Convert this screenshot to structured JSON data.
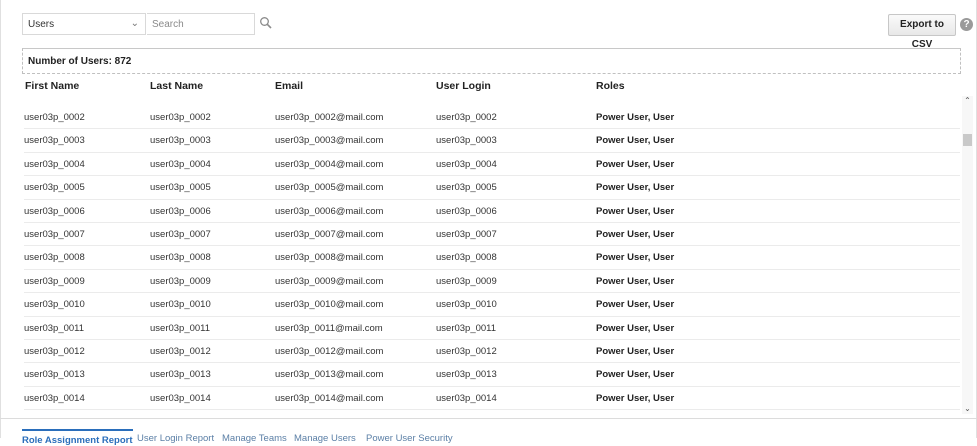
{
  "toolbar": {
    "view_select": "Users",
    "search_placeholder": "Search",
    "export_label": "Export to CSV",
    "help_symbol": "?"
  },
  "summary": {
    "count_label": "Number of Users: 872"
  },
  "table": {
    "columns": [
      "First Name",
      "Last Name",
      "Email",
      "User Login",
      "Roles"
    ],
    "rows": [
      [
        "user03p_0002",
        "user03p_0002",
        "user03p_0002@mail.com",
        "user03p_0002",
        "Power User, User"
      ],
      [
        "user03p_0003",
        "user03p_0003",
        "user03p_0003@mail.com",
        "user03p_0003",
        "Power User, User"
      ],
      [
        "user03p_0004",
        "user03p_0004",
        "user03p_0004@mail.com",
        "user03p_0004",
        "Power User, User"
      ],
      [
        "user03p_0005",
        "user03p_0005",
        "user03p_0005@mail.com",
        "user03p_0005",
        "Power User, User"
      ],
      [
        "user03p_0006",
        "user03p_0006",
        "user03p_0006@mail.com",
        "user03p_0006",
        "Power User, User"
      ],
      [
        "user03p_0007",
        "user03p_0007",
        "user03p_0007@mail.com",
        "user03p_0007",
        "Power User, User"
      ],
      [
        "user03p_0008",
        "user03p_0008",
        "user03p_0008@mail.com",
        "user03p_0008",
        "Power User, User"
      ],
      [
        "user03p_0009",
        "user03p_0009",
        "user03p_0009@mail.com",
        "user03p_0009",
        "Power User, User"
      ],
      [
        "user03p_0010",
        "user03p_0010",
        "user03p_0010@mail.com",
        "user03p_0010",
        "Power User, User"
      ],
      [
        "user03p_0011",
        "user03p_0011",
        "user03p_0011@mail.com",
        "user03p_0011",
        "Power User, User"
      ],
      [
        "user03p_0012",
        "user03p_0012",
        "user03p_0012@mail.com",
        "user03p_0012",
        "Power User, User"
      ],
      [
        "user03p_0013",
        "user03p_0013",
        "user03p_0013@mail.com",
        "user03p_0013",
        "Power User, User"
      ],
      [
        "user03p_0014",
        "user03p_0014",
        "user03p_0014@mail.com",
        "user03p_0014",
        "Power User, User"
      ]
    ]
  },
  "tabs": [
    {
      "label": "Role Assignment Report",
      "active": true
    },
    {
      "label": "User Login Report",
      "active": false
    },
    {
      "label": "Manage Teams",
      "active": false
    },
    {
      "label": "Manage Users",
      "active": false
    },
    {
      "label": "Power User Security",
      "active": false
    }
  ],
  "icons": {
    "select_chevron": "chevron-down-icon",
    "search": "search-icon",
    "help": "help-icon",
    "scroll_up": "chevron-up-icon",
    "scroll_down": "chevron-down-icon"
  },
  "colors": {
    "accent": "#2a6ebb",
    "tab_link": "#5b7fa6"
  }
}
